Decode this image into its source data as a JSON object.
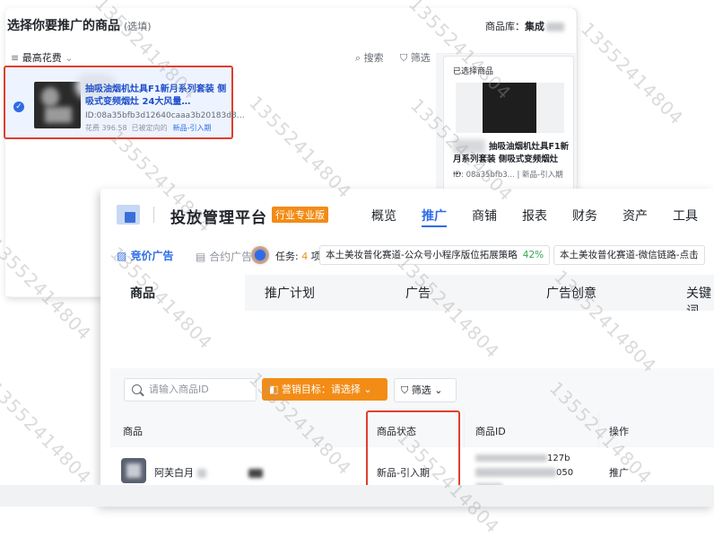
{
  "back_panel": {
    "title": "选择你要推广的商品",
    "title_note": "(选填)",
    "library_label": "商品库：",
    "library_value": "集成",
    "sort_label": "最高花费",
    "search_label": "搜索",
    "filter_label": "筛选",
    "item": {
      "name": "抽吸油烟机灶具F1新月系列套装 侧吸式变频烟灶 24大风量…",
      "id": "ID:08a35bfb3d12640caaa3b20183d8…",
      "spend": "花费 396.58",
      "state": "已被定向的",
      "tag": "新品-引入期"
    },
    "selected_panel": {
      "title": "已选择商品",
      "name": "抽吸油烟机灶具F1新月系列套装 侧吸式变频烟灶 …",
      "id": "ID: 08a35bfb3...",
      "tag": "新品-引入期"
    }
  },
  "app": {
    "title": "投放管理平台",
    "edition": "行业专业版",
    "nav": [
      "概览",
      "推广",
      "商铺",
      "报表",
      "财务",
      "资产",
      "工具"
    ],
    "active_nav": "推广"
  },
  "ad_tabs": {
    "bidding": "竞价广告",
    "contract": "合约广告",
    "task_label": "任务:",
    "task_count": "4",
    "task_unit": "项",
    "chips": [
      {
        "text": "本土美妆普化赛道-公众号小程序版位拓展策略",
        "pct": "42%"
      },
      {
        "text": "本土美妆普化赛道-微信链路-点击",
        "pct": ""
      }
    ]
  },
  "sub_tabs": [
    "商品",
    "推广计划",
    "广告",
    "广告创意",
    "关键词"
  ],
  "toolbar": {
    "search_placeholder": "请输入商品ID",
    "goal_label": "营销目标：请选择",
    "filter_label": "筛选"
  },
  "table": {
    "columns": [
      "商品",
      "商品状态",
      "商品ID",
      "操作"
    ],
    "rows": [
      {
        "name": "阿芙白月",
        "status": "新品-引入期",
        "id_tail1": "127b",
        "id_tail2": "050",
        "action": "推广"
      }
    ]
  },
  "watermark": "13552414804",
  "colors": {
    "primary": "#2e6ce6",
    "accent": "#f28c16",
    "highlight": "#e03e2d"
  }
}
